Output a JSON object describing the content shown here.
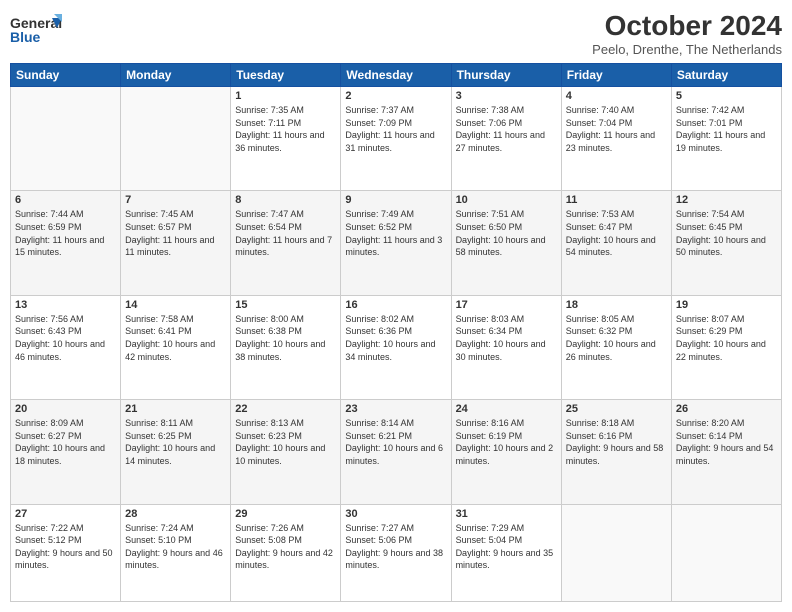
{
  "header": {
    "logo_general": "General",
    "logo_blue": "Blue",
    "title": "October 2024",
    "location": "Peelo, Drenthe, The Netherlands"
  },
  "weekdays": [
    "Sunday",
    "Monday",
    "Tuesday",
    "Wednesday",
    "Thursday",
    "Friday",
    "Saturday"
  ],
  "weeks": [
    [
      {
        "day": "",
        "info": ""
      },
      {
        "day": "",
        "info": ""
      },
      {
        "day": "1",
        "info": "Sunrise: 7:35 AM\nSunset: 7:11 PM\nDaylight: 11 hours and 36 minutes."
      },
      {
        "day": "2",
        "info": "Sunrise: 7:37 AM\nSunset: 7:09 PM\nDaylight: 11 hours and 31 minutes."
      },
      {
        "day": "3",
        "info": "Sunrise: 7:38 AM\nSunset: 7:06 PM\nDaylight: 11 hours and 27 minutes."
      },
      {
        "day": "4",
        "info": "Sunrise: 7:40 AM\nSunset: 7:04 PM\nDaylight: 11 hours and 23 minutes."
      },
      {
        "day": "5",
        "info": "Sunrise: 7:42 AM\nSunset: 7:01 PM\nDaylight: 11 hours and 19 minutes."
      }
    ],
    [
      {
        "day": "6",
        "info": "Sunrise: 7:44 AM\nSunset: 6:59 PM\nDaylight: 11 hours and 15 minutes."
      },
      {
        "day": "7",
        "info": "Sunrise: 7:45 AM\nSunset: 6:57 PM\nDaylight: 11 hours and 11 minutes."
      },
      {
        "day": "8",
        "info": "Sunrise: 7:47 AM\nSunset: 6:54 PM\nDaylight: 11 hours and 7 minutes."
      },
      {
        "day": "9",
        "info": "Sunrise: 7:49 AM\nSunset: 6:52 PM\nDaylight: 11 hours and 3 minutes."
      },
      {
        "day": "10",
        "info": "Sunrise: 7:51 AM\nSunset: 6:50 PM\nDaylight: 10 hours and 58 minutes."
      },
      {
        "day": "11",
        "info": "Sunrise: 7:53 AM\nSunset: 6:47 PM\nDaylight: 10 hours and 54 minutes."
      },
      {
        "day": "12",
        "info": "Sunrise: 7:54 AM\nSunset: 6:45 PM\nDaylight: 10 hours and 50 minutes."
      }
    ],
    [
      {
        "day": "13",
        "info": "Sunrise: 7:56 AM\nSunset: 6:43 PM\nDaylight: 10 hours and 46 minutes."
      },
      {
        "day": "14",
        "info": "Sunrise: 7:58 AM\nSunset: 6:41 PM\nDaylight: 10 hours and 42 minutes."
      },
      {
        "day": "15",
        "info": "Sunrise: 8:00 AM\nSunset: 6:38 PM\nDaylight: 10 hours and 38 minutes."
      },
      {
        "day": "16",
        "info": "Sunrise: 8:02 AM\nSunset: 6:36 PM\nDaylight: 10 hours and 34 minutes."
      },
      {
        "day": "17",
        "info": "Sunrise: 8:03 AM\nSunset: 6:34 PM\nDaylight: 10 hours and 30 minutes."
      },
      {
        "day": "18",
        "info": "Sunrise: 8:05 AM\nSunset: 6:32 PM\nDaylight: 10 hours and 26 minutes."
      },
      {
        "day": "19",
        "info": "Sunrise: 8:07 AM\nSunset: 6:29 PM\nDaylight: 10 hours and 22 minutes."
      }
    ],
    [
      {
        "day": "20",
        "info": "Sunrise: 8:09 AM\nSunset: 6:27 PM\nDaylight: 10 hours and 18 minutes."
      },
      {
        "day": "21",
        "info": "Sunrise: 8:11 AM\nSunset: 6:25 PM\nDaylight: 10 hours and 14 minutes."
      },
      {
        "day": "22",
        "info": "Sunrise: 8:13 AM\nSunset: 6:23 PM\nDaylight: 10 hours and 10 minutes."
      },
      {
        "day": "23",
        "info": "Sunrise: 8:14 AM\nSunset: 6:21 PM\nDaylight: 10 hours and 6 minutes."
      },
      {
        "day": "24",
        "info": "Sunrise: 8:16 AM\nSunset: 6:19 PM\nDaylight: 10 hours and 2 minutes."
      },
      {
        "day": "25",
        "info": "Sunrise: 8:18 AM\nSunset: 6:16 PM\nDaylight: 9 hours and 58 minutes."
      },
      {
        "day": "26",
        "info": "Sunrise: 8:20 AM\nSunset: 6:14 PM\nDaylight: 9 hours and 54 minutes."
      }
    ],
    [
      {
        "day": "27",
        "info": "Sunrise: 7:22 AM\nSunset: 5:12 PM\nDaylight: 9 hours and 50 minutes."
      },
      {
        "day": "28",
        "info": "Sunrise: 7:24 AM\nSunset: 5:10 PM\nDaylight: 9 hours and 46 minutes."
      },
      {
        "day": "29",
        "info": "Sunrise: 7:26 AM\nSunset: 5:08 PM\nDaylight: 9 hours and 42 minutes."
      },
      {
        "day": "30",
        "info": "Sunrise: 7:27 AM\nSunset: 5:06 PM\nDaylight: 9 hours and 38 minutes."
      },
      {
        "day": "31",
        "info": "Sunrise: 7:29 AM\nSunset: 5:04 PM\nDaylight: 9 hours and 35 minutes."
      },
      {
        "day": "",
        "info": ""
      },
      {
        "day": "",
        "info": ""
      }
    ]
  ]
}
